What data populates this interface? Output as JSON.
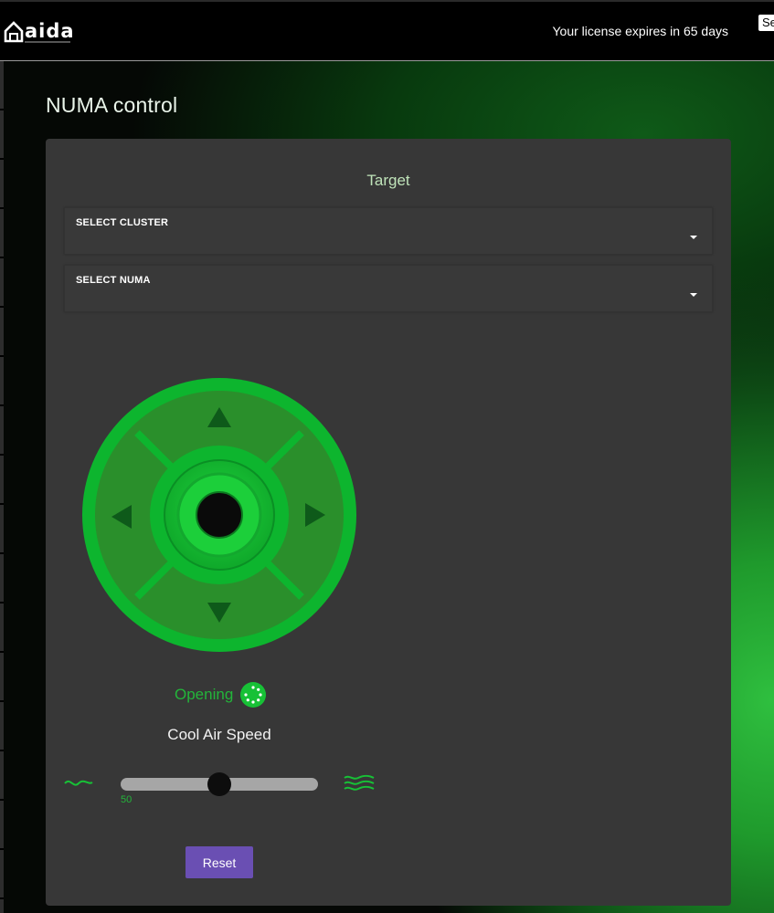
{
  "header": {
    "logo_text": "aida",
    "license_text": "Your license expires in 65 days",
    "search_placeholder": "Se"
  },
  "page": {
    "title": "NUMA control"
  },
  "card": {
    "target_title": "Target",
    "select_cluster_label": "SELECT CLUSTER",
    "select_numa_label": "SELECT NUMA",
    "status_text": "Opening",
    "speed_title": "Cool Air Speed",
    "slider_value": 50,
    "slider_min": 0,
    "slider_max": 100,
    "reset_label": "Reset"
  },
  "icons": {
    "home": "home-icon",
    "caret": "caret-down-icon",
    "up": "arrow-up-icon",
    "down": "arrow-down-icon",
    "left": "arrow-left-icon",
    "right": "arrow-right-icon",
    "spinner": "loading-spinner-icon",
    "wave_low": "low-airflow-icon",
    "wave_high": "high-airflow-icon"
  },
  "colors": {
    "accent_green": "#17c136",
    "pad_green": "#2a8f2b",
    "card_bg": "#373737",
    "reset_purple": "#6a4fb3"
  }
}
